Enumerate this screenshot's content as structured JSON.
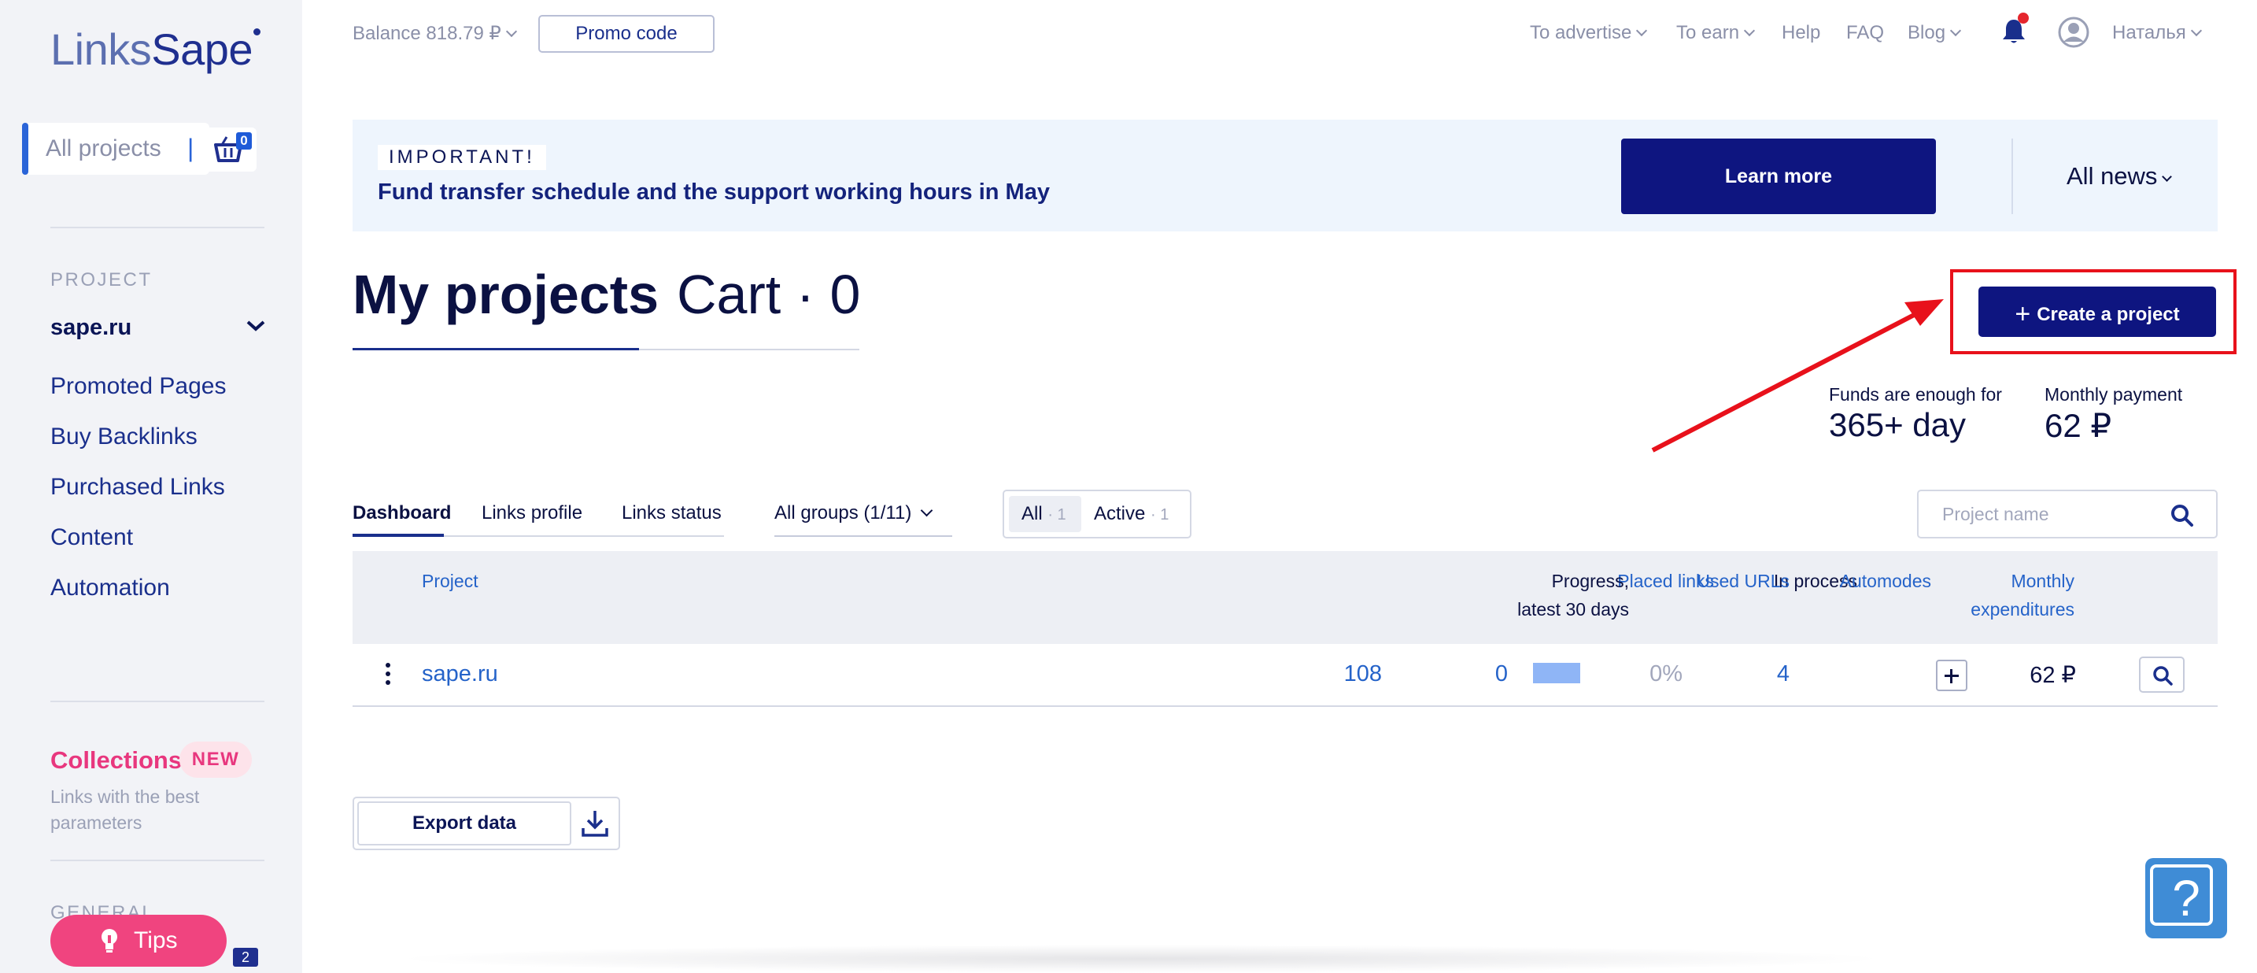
{
  "sidebar": {
    "logo_part1": "Links",
    "logo_part2": "Sape",
    "all_projects": "All projects",
    "all_projects_sep": "|",
    "cart_count": "0",
    "section_project": "PROJECT",
    "current_project": "sape.ru",
    "items": [
      {
        "label": "Promoted Pages"
      },
      {
        "label": "Buy Backlinks"
      },
      {
        "label": "Purchased Links"
      },
      {
        "label": "Content"
      },
      {
        "label": "Automation"
      }
    ],
    "collections_title": "Collections",
    "collections_badge": "NEW",
    "collections_desc": "Links with the best parameters",
    "section_general": "GENERAL",
    "tips_label": "Tips",
    "chat_count": "2"
  },
  "topbar": {
    "balance": "Balance 818.79 ₽",
    "promo": "Promo code",
    "nav": [
      {
        "label": "To advertise",
        "has_dropdown": true
      },
      {
        "label": "To earn",
        "has_dropdown": true
      },
      {
        "label": "Help",
        "has_dropdown": false
      },
      {
        "label": "FAQ",
        "has_dropdown": false
      },
      {
        "label": "Blog",
        "has_dropdown": true
      }
    ],
    "user_name": "Наталья"
  },
  "banner": {
    "tag": "IMPORTANT!",
    "text": "Fund transfer schedule and the support working hours in May",
    "learn_more": "Learn more",
    "all_news": "All news"
  },
  "page": {
    "tab_projects": "My projects",
    "tab_cart": "Cart · 0",
    "create_project": "Create a project",
    "funds_label": "Funds are enough for",
    "funds_value": "365+ day",
    "payment_label": "Monthly payment",
    "payment_value": "62 ₽"
  },
  "filters": {
    "subtabs": [
      "Dashboard",
      "Links profile",
      "Links status"
    ],
    "groups": "All groups (1/11)",
    "seg_all": "All",
    "seg_all_count": "· 1",
    "seg_active": "Active",
    "seg_active_count": "· 1",
    "search_placeholder": "Project name"
  },
  "table": {
    "headers": {
      "project": "Project",
      "placed": "Placed links",
      "in_process": "In process",
      "progress_1": "Progress,",
      "progress_2": "latest 30 days",
      "used_urls": "Used URLs",
      "automodes": "Automodes",
      "monthly_1": "Monthly",
      "monthly_2": "expenditures"
    },
    "rows": [
      {
        "project": "sape.ru",
        "placed": "108",
        "in_process": "0",
        "progress": "0%",
        "used_urls": "4",
        "monthly": "62 ₽"
      }
    ]
  },
  "export_label": "Export data",
  "help_label": "?",
  "colors": {
    "primary": "#0e1580",
    "link": "#2563c9",
    "accent_pink": "#f0447f",
    "highlight_red": "#e8111b",
    "banner_bg": "#eef5fd"
  }
}
